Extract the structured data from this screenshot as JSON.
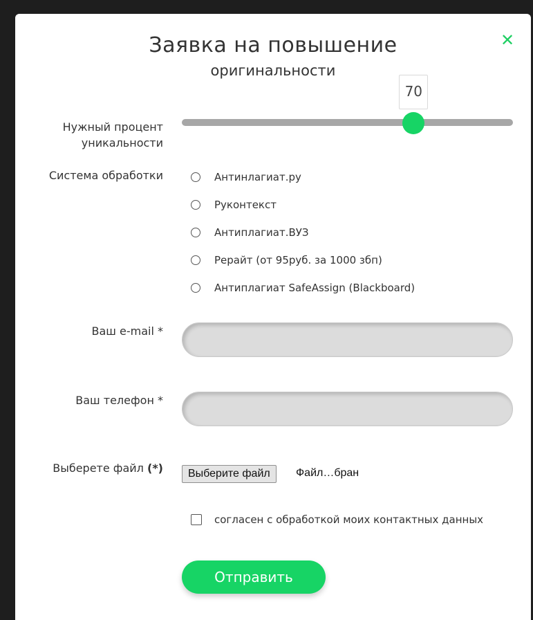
{
  "modal": {
    "title": "Заявка на повышение",
    "subtitle": "оригинальности",
    "close_icon": "close-icon"
  },
  "uniqueness": {
    "label": "Нужный процент уникальности",
    "value": "70",
    "min": 0,
    "max": 100,
    "accent_color": "#17d465"
  },
  "system": {
    "label": "Система обработки",
    "options": [
      "Антинлагиат.ру",
      "Руконтекст",
      "Антиплагиат.ВУЗ",
      "Рерайт (от 95руб. за 1000 збп)",
      "Антиплагиат SafeAssign (Blackboard)"
    ]
  },
  "email": {
    "label": "Ваш e-mail *",
    "value": "",
    "placeholder": ""
  },
  "phone": {
    "label": "Ваш телефон *",
    "value": "",
    "placeholder": ""
  },
  "file": {
    "label": "Выберете файл",
    "label_required": "(*)",
    "button_label": "Выберите файл",
    "status": "Файл…бран"
  },
  "consent": {
    "label": "согласен с обработкой моих контактных данных",
    "checked": false
  },
  "submit_label": "Отправить"
}
